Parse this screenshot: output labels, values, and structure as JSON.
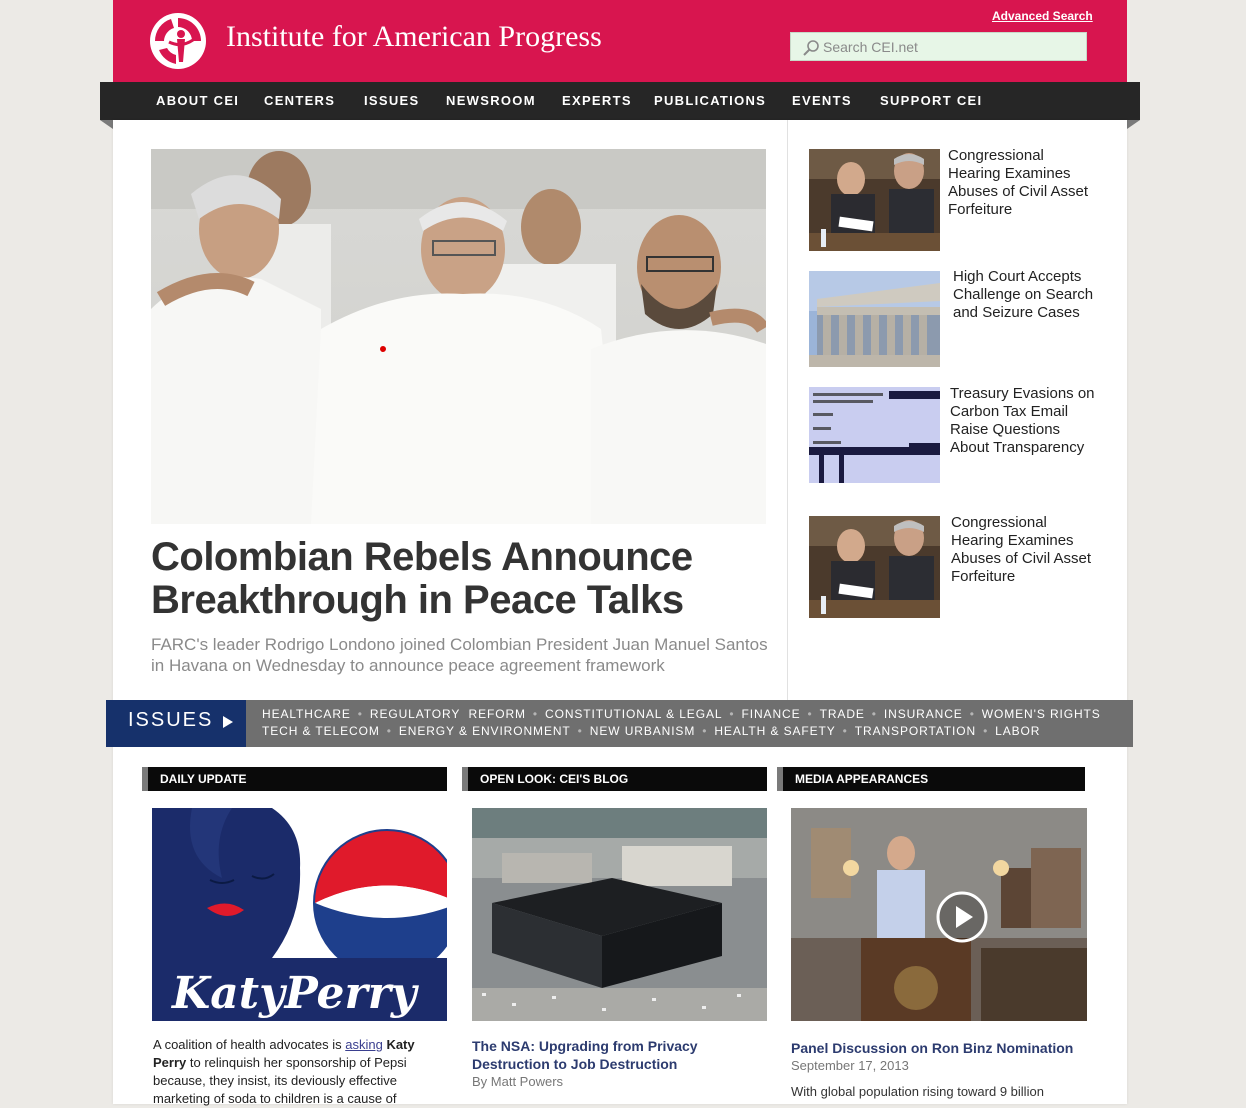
{
  "header": {
    "site_title": "Institute for American Progress",
    "advanced_search": "Advanced Search",
    "search_placeholder": "Search CEI.net",
    "brand_color": "#d8154f"
  },
  "nav": {
    "items": [
      "ABOUT CEI",
      "CENTERS",
      "ISSUES",
      "NEWSROOM",
      "EXPERTS",
      "PUBLICATIONS",
      "EVENTS",
      "SUPPORT CEI"
    ]
  },
  "feature": {
    "headline_line1": "Colombian Rebels Announce",
    "headline_line2": "Breakthrough in Peace Talks",
    "deck": "FARC's leader Rodrigo Londono joined Colombian President Juan Manuel Santos in Havana on Wednesday to announce peace agreement framework"
  },
  "sidebar": {
    "items": [
      {
        "title": "Congressional Hearing Examines Abuses of Civil Asset Forfeiture",
        "thumb": "hearing-photo"
      },
      {
        "title": "High Court Accepts Challenge on Search and Seizure Cases",
        "thumb": "supreme-court-photo"
      },
      {
        "title": "Treasury Evasions on Carbon Tax Email Raise Questions About Transparency",
        "thumb": "email-document-photo"
      },
      {
        "title": "Congressional Hearing Examines Abuses of Civil Asset Forfeiture",
        "thumb": "hearing-photo"
      }
    ]
  },
  "issues": {
    "label": "ISSUES",
    "row1": [
      "HEALTHCARE",
      "REGULATORY  REFORM",
      "CONSTITUTIONAL & LEGAL",
      "FINANCE",
      "TRADE",
      "INSURANCE",
      "WOMEN'S RIGHTS"
    ],
    "row2": [
      "TECH & TELECOM",
      "ENERGY & ENVIRONMENT",
      "NEW URBANISM",
      "HEALTH & SAFETY",
      "TRANSPORTATION",
      "LABOR"
    ],
    "tab_color": "#16316b",
    "bar_color": "#6f6f6f"
  },
  "columns": {
    "daily": {
      "heading": "DAILY UPDATE",
      "text_before": "A coalition of health advocates is ",
      "link": "asking",
      "space": " ",
      "bold1": "Katy",
      "bold2": "Perry",
      "text_after": " to relinquish her sponsorship of Pepsi because, they insist, its deviously effective marketing of soda to children is a cause of",
      "art_text": "KatyPerry"
    },
    "blog": {
      "heading": "OPEN LOOK: CEI'S BLOG",
      "title": "The NSA: Upgrading from Privacy Destruction to Job Destruction",
      "byline": "By Matt Powers"
    },
    "media": {
      "heading": "MEDIA APPEARANCES",
      "title": "Panel Discussion on Ron Binz Nomination",
      "date": "September 17, 2013",
      "text": "With global population rising toward 9 billion"
    }
  }
}
